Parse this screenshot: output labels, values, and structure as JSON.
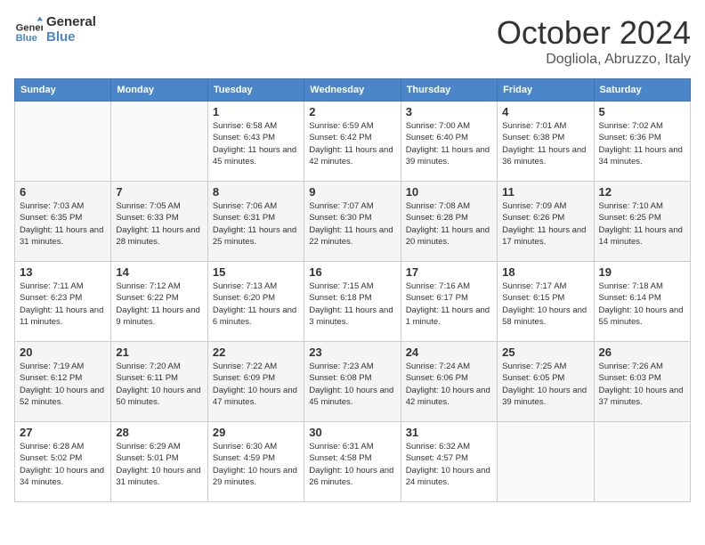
{
  "header": {
    "logo_line1": "General",
    "logo_line2": "Blue",
    "month": "October 2024",
    "location": "Dogliola, Abruzzo, Italy"
  },
  "days_of_week": [
    "Sunday",
    "Monday",
    "Tuesday",
    "Wednesday",
    "Thursday",
    "Friday",
    "Saturday"
  ],
  "weeks": [
    [
      {
        "day": "",
        "detail": ""
      },
      {
        "day": "",
        "detail": ""
      },
      {
        "day": "1",
        "detail": "Sunrise: 6:58 AM\nSunset: 6:43 PM\nDaylight: 11 hours and 45 minutes."
      },
      {
        "day": "2",
        "detail": "Sunrise: 6:59 AM\nSunset: 6:42 PM\nDaylight: 11 hours and 42 minutes."
      },
      {
        "day": "3",
        "detail": "Sunrise: 7:00 AM\nSunset: 6:40 PM\nDaylight: 11 hours and 39 minutes."
      },
      {
        "day": "4",
        "detail": "Sunrise: 7:01 AM\nSunset: 6:38 PM\nDaylight: 11 hours and 36 minutes."
      },
      {
        "day": "5",
        "detail": "Sunrise: 7:02 AM\nSunset: 6:36 PM\nDaylight: 11 hours and 34 minutes."
      }
    ],
    [
      {
        "day": "6",
        "detail": "Sunrise: 7:03 AM\nSunset: 6:35 PM\nDaylight: 11 hours and 31 minutes."
      },
      {
        "day": "7",
        "detail": "Sunrise: 7:05 AM\nSunset: 6:33 PM\nDaylight: 11 hours and 28 minutes."
      },
      {
        "day": "8",
        "detail": "Sunrise: 7:06 AM\nSunset: 6:31 PM\nDaylight: 11 hours and 25 minutes."
      },
      {
        "day": "9",
        "detail": "Sunrise: 7:07 AM\nSunset: 6:30 PM\nDaylight: 11 hours and 22 minutes."
      },
      {
        "day": "10",
        "detail": "Sunrise: 7:08 AM\nSunset: 6:28 PM\nDaylight: 11 hours and 20 minutes."
      },
      {
        "day": "11",
        "detail": "Sunrise: 7:09 AM\nSunset: 6:26 PM\nDaylight: 11 hours and 17 minutes."
      },
      {
        "day": "12",
        "detail": "Sunrise: 7:10 AM\nSunset: 6:25 PM\nDaylight: 11 hours and 14 minutes."
      }
    ],
    [
      {
        "day": "13",
        "detail": "Sunrise: 7:11 AM\nSunset: 6:23 PM\nDaylight: 11 hours and 11 minutes."
      },
      {
        "day": "14",
        "detail": "Sunrise: 7:12 AM\nSunset: 6:22 PM\nDaylight: 11 hours and 9 minutes."
      },
      {
        "day": "15",
        "detail": "Sunrise: 7:13 AM\nSunset: 6:20 PM\nDaylight: 11 hours and 6 minutes."
      },
      {
        "day": "16",
        "detail": "Sunrise: 7:15 AM\nSunset: 6:18 PM\nDaylight: 11 hours and 3 minutes."
      },
      {
        "day": "17",
        "detail": "Sunrise: 7:16 AM\nSunset: 6:17 PM\nDaylight: 11 hours and 1 minute."
      },
      {
        "day": "18",
        "detail": "Sunrise: 7:17 AM\nSunset: 6:15 PM\nDaylight: 10 hours and 58 minutes."
      },
      {
        "day": "19",
        "detail": "Sunrise: 7:18 AM\nSunset: 6:14 PM\nDaylight: 10 hours and 55 minutes."
      }
    ],
    [
      {
        "day": "20",
        "detail": "Sunrise: 7:19 AM\nSunset: 6:12 PM\nDaylight: 10 hours and 52 minutes."
      },
      {
        "day": "21",
        "detail": "Sunrise: 7:20 AM\nSunset: 6:11 PM\nDaylight: 10 hours and 50 minutes."
      },
      {
        "day": "22",
        "detail": "Sunrise: 7:22 AM\nSunset: 6:09 PM\nDaylight: 10 hours and 47 minutes."
      },
      {
        "day": "23",
        "detail": "Sunrise: 7:23 AM\nSunset: 6:08 PM\nDaylight: 10 hours and 45 minutes."
      },
      {
        "day": "24",
        "detail": "Sunrise: 7:24 AM\nSunset: 6:06 PM\nDaylight: 10 hours and 42 minutes."
      },
      {
        "day": "25",
        "detail": "Sunrise: 7:25 AM\nSunset: 6:05 PM\nDaylight: 10 hours and 39 minutes."
      },
      {
        "day": "26",
        "detail": "Sunrise: 7:26 AM\nSunset: 6:03 PM\nDaylight: 10 hours and 37 minutes."
      }
    ],
    [
      {
        "day": "27",
        "detail": "Sunrise: 6:28 AM\nSunset: 5:02 PM\nDaylight: 10 hours and 34 minutes."
      },
      {
        "day": "28",
        "detail": "Sunrise: 6:29 AM\nSunset: 5:01 PM\nDaylight: 10 hours and 31 minutes."
      },
      {
        "day": "29",
        "detail": "Sunrise: 6:30 AM\nSunset: 4:59 PM\nDaylight: 10 hours and 29 minutes."
      },
      {
        "day": "30",
        "detail": "Sunrise: 6:31 AM\nSunset: 4:58 PM\nDaylight: 10 hours and 26 minutes."
      },
      {
        "day": "31",
        "detail": "Sunrise: 6:32 AM\nSunset: 4:57 PM\nDaylight: 10 hours and 24 minutes."
      },
      {
        "day": "",
        "detail": ""
      },
      {
        "day": "",
        "detail": ""
      }
    ]
  ]
}
